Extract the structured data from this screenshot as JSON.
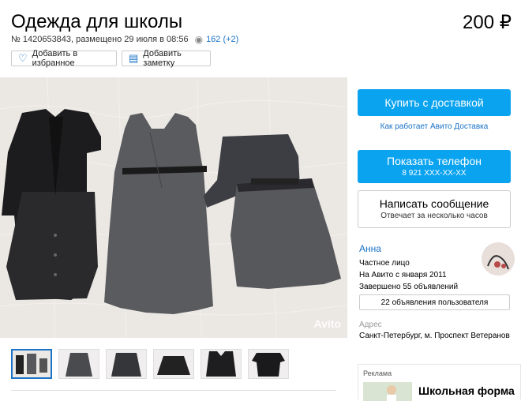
{
  "listing": {
    "title": "Одежда для школы",
    "price": "200 ₽",
    "meta": "№ 1420653843, размещено 29 июля в 08:56",
    "views": "162 (+2)"
  },
  "actions": {
    "favorite": "Добавить в избранное",
    "note": "Добавить заметку"
  },
  "gallery": {
    "watermark": "Avito",
    "thumb_count": 6
  },
  "sidebar": {
    "buy": "Купить с доставкой",
    "delivery_link": "Как работает Авито Доставка",
    "phone_label": "Показать телефон",
    "phone_number": "8 921 XXX-XX-XX",
    "message_label": "Написать сообщение",
    "message_sub": "Отвечает за несколько часов"
  },
  "seller": {
    "name": "Анна",
    "type": "Частное лицо",
    "since": "На Авито с января 2011",
    "completed": "Завершено 55 объявлений",
    "items_button": "22 объявления пользователя",
    "address_label": "Адрес",
    "address": "Санкт-Петербург, м. Проспект Ветеранов"
  },
  "ad": {
    "label": "Реклама",
    "title": "Школьная форма"
  },
  "colors": {
    "accent": "#0aa3f0",
    "link": "#1a73c7"
  }
}
